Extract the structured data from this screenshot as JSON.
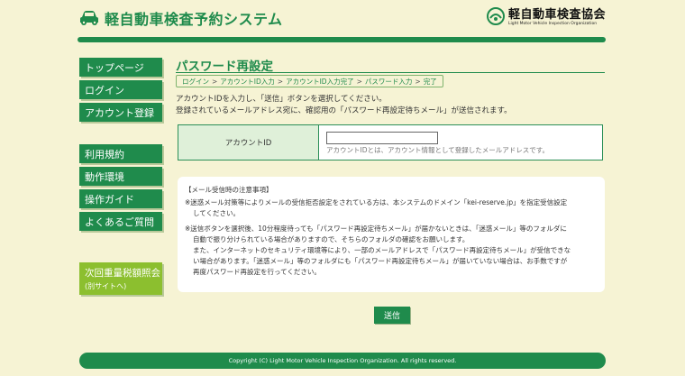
{
  "header": {
    "title": "軽自動車検査予約システム",
    "org_name_jp": "軽自動車検査協会",
    "org_name_en": "Light Motor Vehicle Inspection Organization"
  },
  "sidebar": {
    "items": [
      {
        "label": "トップページ"
      },
      {
        "label": "ログイン"
      },
      {
        "label": "アカウント登録"
      },
      {
        "label": "利用規約"
      },
      {
        "label": "動作環境"
      },
      {
        "label": "操作ガイド"
      },
      {
        "label": "よくあるご質問"
      }
    ],
    "external": {
      "label": "次回重量税額照会",
      "sub": "(別サイトへ)"
    }
  },
  "main": {
    "title": "パスワード再設定",
    "breadcrumb": [
      "ログイン",
      "アカウントID入力",
      "アカウントID入力完了",
      "パスワード入力",
      "完了"
    ],
    "breadcrumb_sep": ">",
    "intro_line1": "アカウントIDを入力し、「送信」ボタンを選択してください。",
    "intro_line2": "登録されているメールアドレス宛に、確認用の「パスワード再設定待ちメール」が送信されます。",
    "form": {
      "label": "アカウントID",
      "value": "",
      "hint": "アカウントIDとは、アカウント情報として登録したメールアドレスです。"
    },
    "notice": {
      "heading": "【メール受信時の注意事項】",
      "item1_line1": "※迷惑メール対策等によりメールの受信拒否設定をされている方は、本システムのドメイン「kei-reserve.jp」を指定受信設定",
      "item1_line2": "してください。",
      "item2_line1": "※送信ボタンを選択後、10分程度待っても「パスワード再設定待ちメール」が届かないときは、「迷惑メール」等のフォルダに",
      "item2_line2": "自動で振り分けられている場合がありますので、そちらのフォルダの確認をお願いします。",
      "item2_line3": "また、インターネットのセキュリティ環境等により、一部のメールアドレスで「パスワード再設定待ちメール」が受信できな",
      "item2_line4": "い場合があります。「迷惑メール」等のフォルダにも「パスワード再設定待ちメール」が届いていない場合は、お手数ですが",
      "item2_line5": "再度パスワード再設定を行ってください。"
    },
    "submit_label": "送信"
  },
  "footer": {
    "copyright": "Copyright (C) Light Motor Vehicle Inspection Organization. All rights reserved."
  },
  "colors": {
    "brand_green": "#1f8b4c",
    "lime": "#8cbf2f",
    "background": "#f6f3d4"
  }
}
